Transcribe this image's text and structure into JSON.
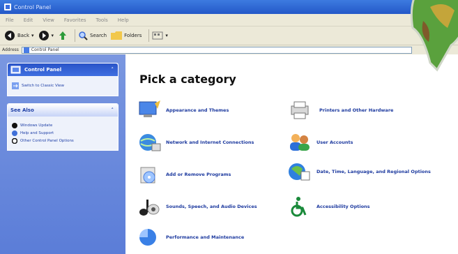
{
  "window": {
    "title": "Control Panel"
  },
  "menu": [
    "File",
    "Edit",
    "View",
    "Favorites",
    "Tools",
    "Help"
  ],
  "toolbar": {
    "back": "Back",
    "search": "Search",
    "folders": "Folders"
  },
  "address": {
    "label": "Address",
    "value": "Control Panel"
  },
  "taskpane": {
    "control_panel": {
      "title": "Control Panel",
      "switch": "Switch to Classic View"
    },
    "see_also": {
      "title": "See Also",
      "items": [
        "Windows Update",
        "Help and Support",
        "Other Control Panel Options"
      ]
    }
  },
  "main": {
    "heading": "Pick a category",
    "categories": [
      "Appearance and Themes",
      "Printers and Other Hardware",
      "Network and Internet Connections",
      "User Accounts",
      "Add or Remove Programs",
      "Date, Time, Language, and Regional Options",
      "Sounds, Speech, and Audio Devices",
      "Accessibility Options",
      "Performance and Maintenance"
    ]
  }
}
